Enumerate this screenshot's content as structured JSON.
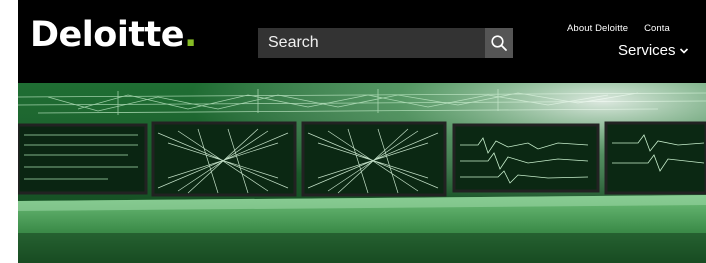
{
  "brand": {
    "name": "Deloitte",
    "dot": ".",
    "accent_color": "#86bc25"
  },
  "search": {
    "placeholder": "Search",
    "icon": "search-icon"
  },
  "nav": {
    "top_links": [
      "About Deloitte",
      "Conta"
    ],
    "main_item": "Services",
    "main_icon": "chevron-down-icon"
  },
  "hero": {
    "description_icon": "control-room-monitors-image"
  },
  "colors": {
    "header_bg": "#000000",
    "search_bg": "#333333",
    "hero_tint": "#1d6b31"
  }
}
